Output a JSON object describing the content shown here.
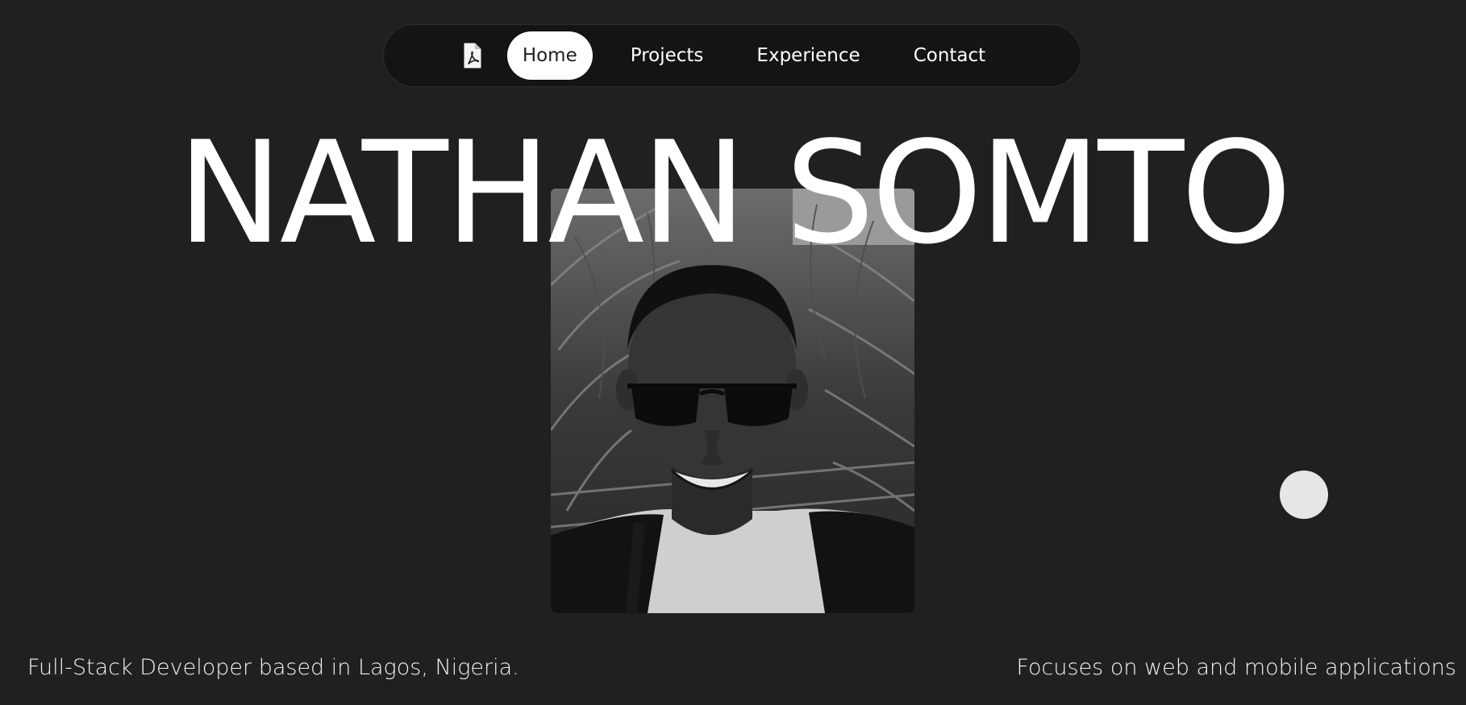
{
  "nav": {
    "resume_icon": "pdf-file-icon",
    "links": [
      {
        "label": "Home",
        "active": true
      },
      {
        "label": "Projects",
        "active": false
      },
      {
        "label": "Experience",
        "active": false
      },
      {
        "label": "Contact",
        "active": false
      }
    ]
  },
  "hero": {
    "name": "NATHAN SOMTO",
    "photo_description_hidden": ""
  },
  "taglines": {
    "left": "Full-Stack Developer based in Lagos, Nigeria.",
    "right": "Focuses on web and mobile applications"
  },
  "colors": {
    "background": "#202020",
    "nav_background": "#141414",
    "active_pill": "#ffffff",
    "cursor_dot": "#e6e6e6"
  }
}
